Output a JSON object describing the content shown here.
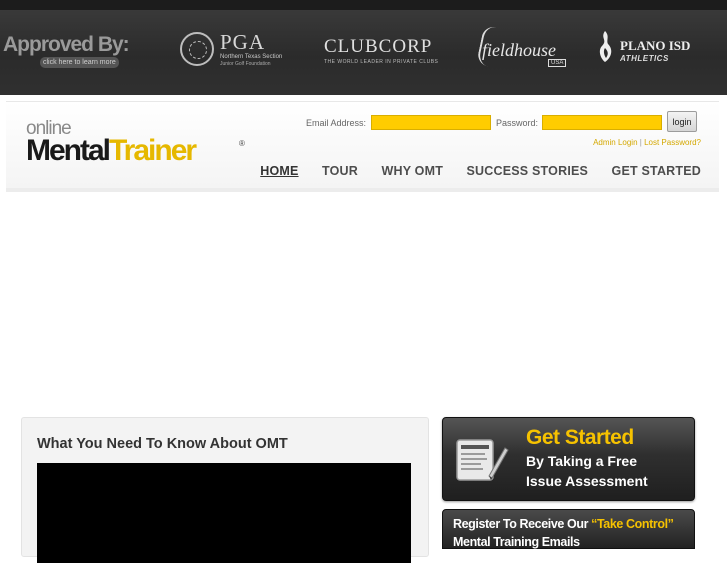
{
  "approved": {
    "label": "Approved By:",
    "learn_more": "click here to learn more",
    "pga": {
      "name": "PGA",
      "sub": "Northern Texas Section",
      "sub2": "Junior Golf Foundation"
    },
    "clubcorp": {
      "name": "CLUBCORP",
      "tag": "THE WORLD LEADER IN PRIVATE CLUBS"
    },
    "fieldhouse": {
      "name": "fieldhouse",
      "badge": "USA"
    },
    "plano": {
      "name": "PLANO ISD",
      "sub": "ATHLETICS"
    }
  },
  "logo": {
    "online": "online",
    "mental": "Mental",
    "trainer": "Trainer",
    "reg": "®"
  },
  "login": {
    "email_label": "Email Address:",
    "email_value": "",
    "password_label": "Password:",
    "password_value": "",
    "button": "login",
    "admin_link": "Admin Login",
    "separator": " | ",
    "lost_link": "Lost Password?"
  },
  "nav": [
    {
      "label": "HOME",
      "active": true
    },
    {
      "label": "TOUR"
    },
    {
      "label": "WHY OMT"
    },
    {
      "label": "SUCCESS STORIES"
    },
    {
      "label": "GET STARTED"
    }
  ],
  "video_panel": {
    "title": "What You Need To Know About OMT"
  },
  "cta": {
    "headline": "Get Started",
    "line2": "By Taking a Free",
    "line3": "Issue Assessment"
  },
  "register": {
    "prefix": "Register To Receive Our ",
    "highlight": "“Take Control”",
    "line2": "Mental Training Emails"
  },
  "colors": {
    "accent": "#ffcc00",
    "dark": "#2b2b2b",
    "nav_text": "#4d4d4d"
  }
}
